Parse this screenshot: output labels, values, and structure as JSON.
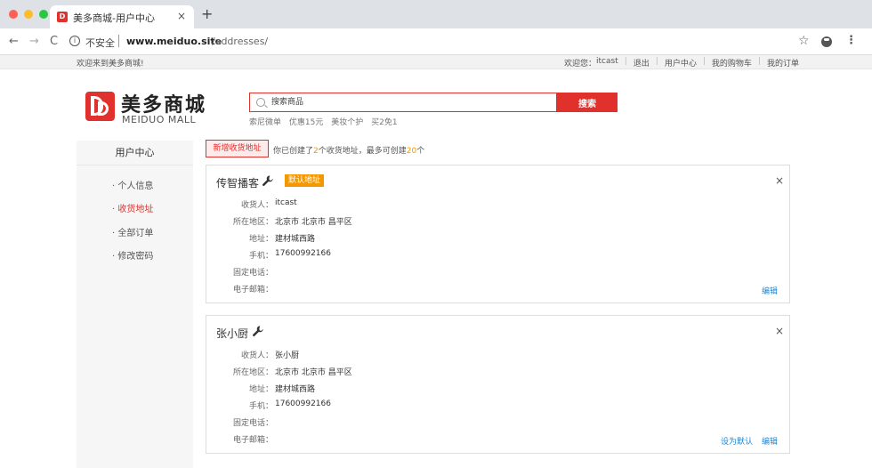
{
  "browser": {
    "tab_title": "美多商城-用户中心",
    "tab_icon_text": "D",
    "tab_close": "×",
    "new_tab": "+",
    "back": "←",
    "forward": "→",
    "reload": "C",
    "info_icon": "i",
    "insecure_label": "不安全",
    "url_host": "www.meiduo.site",
    "url_path": "/addresses/",
    "star": "☆",
    "menu": "⋮"
  },
  "top_bar": {
    "welcome": "欢迎来到美多商城!",
    "greeting": "欢迎您：",
    "username": "itcast",
    "logout": "退出",
    "user_center": "用户中心",
    "cart": "我的购物车",
    "orders": "我的订单",
    "separator": "|"
  },
  "logo": {
    "cn": "美多商城",
    "en": "MEIDUO MALL"
  },
  "search": {
    "placeholder": "搜索商品",
    "button": "搜索",
    "hotwords": [
      "索尼微单",
      "优惠15元",
      "美妆个护",
      "买2免1"
    ]
  },
  "sidebar": {
    "title": "用户中心",
    "items": [
      {
        "label": "· 个人信息",
        "active": false
      },
      {
        "label": "· 收货地址",
        "active": true
      },
      {
        "label": "· 全部订单",
        "active": false
      },
      {
        "label": "· 修改密码",
        "active": false
      }
    ]
  },
  "address_header": {
    "add_button": "新增收货地址",
    "tip_prefix": "你已创建了",
    "created_count": "2",
    "tip_middle": "个收货地址，最多可创建",
    "max_count": "20",
    "tip_suffix": "个"
  },
  "labels": {
    "receiver": "收货人：",
    "region": "所在地区：",
    "address": "地址：",
    "mobile": "手机：",
    "tel": "固定电话：",
    "email": "电子邮箱：",
    "edit": "编辑",
    "set_default": "设为默认",
    "close": "×"
  },
  "addresses": [
    {
      "title": "传智播客",
      "is_default": true,
      "default_badge": "默认地址",
      "receiver": "itcast",
      "region": "北京市 北京市 昌平区",
      "address": "建材城西路",
      "mobile": "17600992166",
      "tel": "",
      "email": ""
    },
    {
      "title": "张小厨",
      "is_default": false,
      "receiver": "张小厨",
      "region": "北京市 北京市 昌平区",
      "address": "建材城西路",
      "mobile": "17600992166",
      "tel": "",
      "email": ""
    }
  ],
  "colors": {
    "brand_red": "#e0312c",
    "default_badge_orange": "#f39800",
    "link_blue": "#1a88d8"
  }
}
